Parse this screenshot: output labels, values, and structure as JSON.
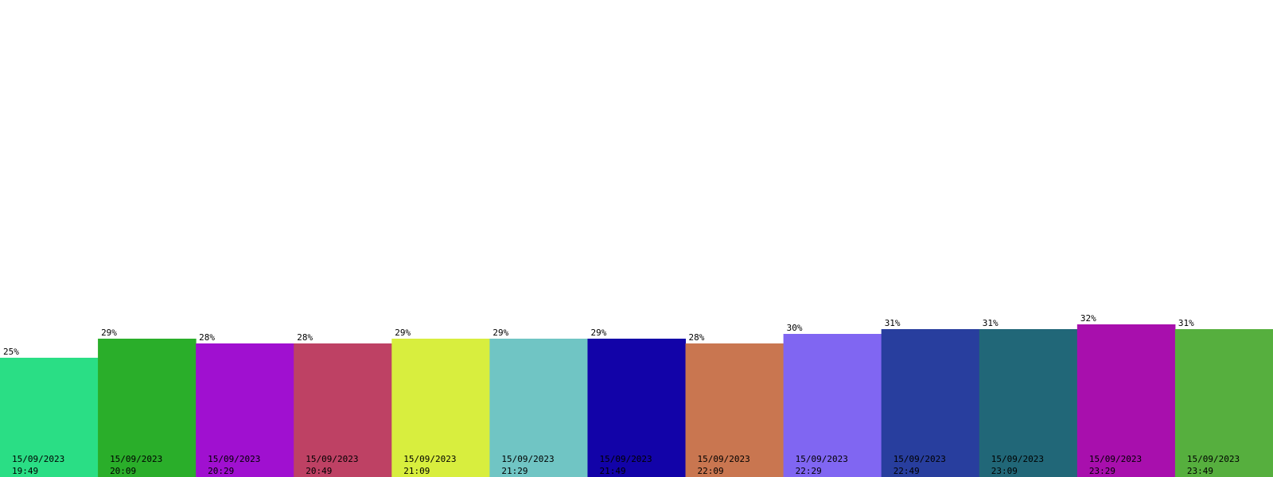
{
  "chart_data": {
    "type": "bar",
    "categories": [
      [
        "15/09/2023",
        "19:49"
      ],
      [
        "15/09/2023",
        "20:09"
      ],
      [
        "15/09/2023",
        "20:29"
      ],
      [
        "15/09/2023",
        "20:49"
      ],
      [
        "15/09/2023",
        "21:09"
      ],
      [
        "15/09/2023",
        "21:29"
      ],
      [
        "15/09/2023",
        "21:49"
      ],
      [
        "15/09/2023",
        "22:09"
      ],
      [
        "15/09/2023",
        "22:29"
      ],
      [
        "15/09/2023",
        "22:49"
      ],
      [
        "15/09/2023",
        "23:09"
      ],
      [
        "15/09/2023",
        "23:29"
      ],
      [
        "15/09/2023",
        "23:49"
      ]
    ],
    "values": [
      25,
      29,
      28,
      28,
      29,
      29,
      29,
      28,
      30,
      31,
      31,
      32,
      31
    ],
    "value_labels": [
      "25%",
      "29%",
      "28%",
      "28%",
      "29%",
      "29%",
      "29%",
      "28%",
      "30%",
      "31%",
      "31%",
      "32%",
      "31%"
    ],
    "colors": [
      "#2ade85",
      "#2aae2a",
      "#a010d0",
      "#be4164",
      "#d8ee3e",
      "#70c5c4",
      "#1203a8",
      "#c97650",
      "#8066f2",
      "#283e9e",
      "#216778",
      "#a80fad",
      "#56af3e"
    ],
    "ylim": [
      0,
      100
    ],
    "grid": false,
    "legend": "none"
  }
}
